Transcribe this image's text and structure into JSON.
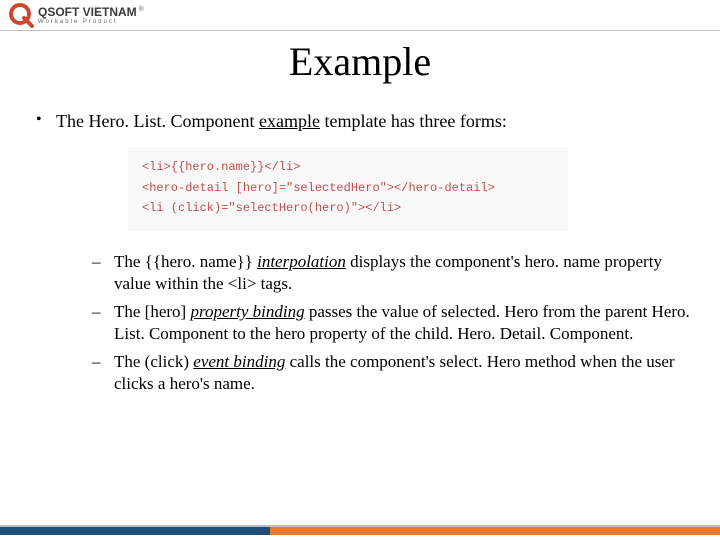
{
  "logo": {
    "title": "QSOFT VIETNAM",
    "tagline": "Workable Product"
  },
  "title": "Example",
  "bullet1": {
    "prefix": "The Hero. List. Component ",
    "link": "example",
    "suffix": " template has three forms:"
  },
  "code": {
    "line1": "<li>{{hero.name}}</li>",
    "line2": "<hero-detail [hero]=\"selectedHero\"></hero-detail>",
    "line3": "<li (click)=\"selectHero(hero)\"></li>"
  },
  "sub": {
    "a": {
      "p1": "The {{hero. name}} ",
      "link": "interpolation",
      "p2": " displays the component's hero. name property value within the <li> tags."
    },
    "b": {
      "p1": "The [hero] ",
      "link": "property binding",
      "p2": " passes the value of selected. Hero from the parent Hero. List. Component to the hero property of the child. Hero. Detail. Component."
    },
    "c": {
      "p1": "The (click) ",
      "link": "event binding",
      "p2": " calls the component's select. Hero method when the user clicks a hero's name."
    }
  }
}
